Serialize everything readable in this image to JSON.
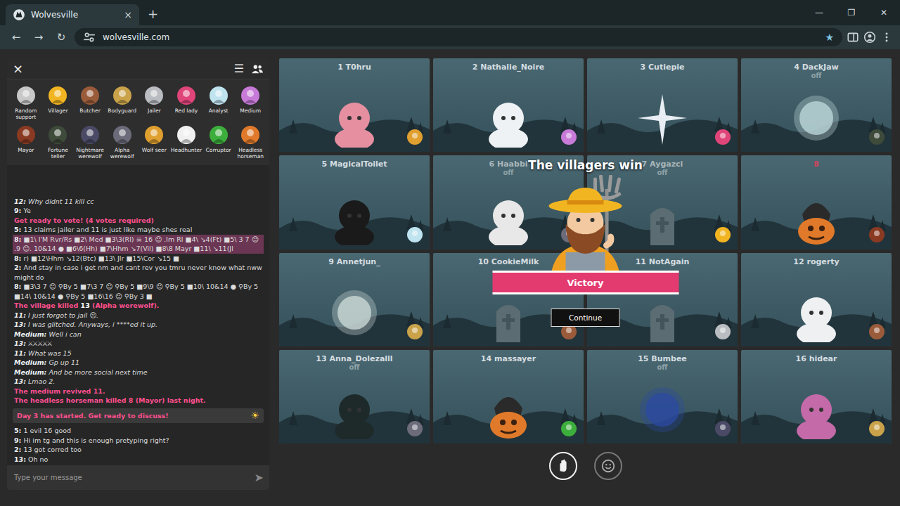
{
  "browser": {
    "tab_title": "Wolvesville",
    "tab_close": "×",
    "new_tab": "+",
    "window_controls": [
      "—",
      "❐",
      "✕"
    ],
    "nav": [
      "←",
      "→",
      "↻"
    ],
    "url": "wolvesville.com",
    "star": "★"
  },
  "panel": {
    "close": "×",
    "menu": "☰",
    "roles": [
      {
        "label": "Random support",
        "color": "#c8c8c8"
      },
      {
        "label": "Villager",
        "color": "#f2b522"
      },
      {
        "label": "Butcher",
        "color": "#9a5b3a"
      },
      {
        "label": "Bodyguard",
        "color": "#c9a24a"
      },
      {
        "label": "Jailer",
        "color": "#b9bcc0"
      },
      {
        "label": "Red lady",
        "color": "#e0457a"
      },
      {
        "label": "Analyst",
        "color": "#bfe3ef"
      },
      {
        "label": "Medium",
        "color": "#c77ad8"
      },
      {
        "label": "Mayor",
        "color": "#8a3a22"
      },
      {
        "label": "Fortune teller",
        "color": "#3e4a3a"
      },
      {
        "label": "Nightmare werewolf",
        "color": "#4a4a66"
      },
      {
        "label": "Alpha werewolf",
        "color": "#6b6b7a"
      },
      {
        "label": "Wolf seer",
        "color": "#e0a030"
      },
      {
        "label": "Headhunter",
        "color": "#f0f0f0"
      },
      {
        "label": "Corruptor",
        "color": "#3cae3c"
      },
      {
        "label": "Headless horseman",
        "color": "#e07a2a"
      }
    ],
    "chat": [
      {
        "kind": "italic",
        "speaker": "12:",
        "text": "Why didnt 11 kill cc"
      },
      {
        "kind": "plain",
        "speaker": "9:",
        "text": "Ye"
      },
      {
        "kind": "system",
        "text": "Get ready to vote! (4 votes required)"
      },
      {
        "kind": "plain",
        "speaker": "5:",
        "text": "13 claims jailer and 11 is just like maybe shes real"
      },
      {
        "kind": "note",
        "speaker": "8:",
        "text": "■1\\ I'M Rvr/Rs ■2\\ Med ■3\\3(Rl) ☠ 16 ☺ .Im Rl ■4\\ ↘4(Ft) ■5\\ 3 7 ☺ .9 ☺. 10&14 ● ■6\\6(Hh) ■7\\Hhm ↘7(Vil) ■8\\8 Mayr ■11\\ ↘11(Jl"
      },
      {
        "kind": "plain",
        "speaker": "8:",
        "text": "r) ■12\\Hhm ↘12(Btc) ■13\\ Jlr ■15\\Cor ↘15 ■"
      },
      {
        "kind": "plain",
        "speaker": "2:",
        "text": "And stay in case i get nm and cant rev you tmru never know what nww might do"
      },
      {
        "kind": "plain",
        "speaker": "8:",
        "text": "■3\\3 7 ☺ ⚲By 5 ■7\\3 7 ☺ ⚲By 5 ■9\\9 ☺ ⚲By 5 ■10\\ 10&14 ● ⚲By 5 ■14\\ 10&14 ● ⚲By 5 ■16\\16 ☺ ⚲By 3 ■"
      },
      {
        "kind": "kill",
        "before": "The village killed ",
        "target": "13",
        "after": " (Alpha werewolf)."
      },
      {
        "kind": "italic",
        "speaker": "11:",
        "text": "I just forgot to jail ☹."
      },
      {
        "kind": "italic",
        "speaker": "13:",
        "text": "I was glitched. Anyways, i ****ed it up."
      },
      {
        "kind": "italic",
        "speaker": "Medium:",
        "text": "Well i can"
      },
      {
        "kind": "italic",
        "speaker": "13:",
        "text": "⚔⚔⚔⚔⚔"
      },
      {
        "kind": "italic",
        "speaker": "11:",
        "text": "What was 15"
      },
      {
        "kind": "italic",
        "speaker": "Medium:",
        "text": "Gp up 11"
      },
      {
        "kind": "italic",
        "speaker": "Medium:",
        "text": "And be more social next time"
      },
      {
        "kind": "italic",
        "speaker": "13:",
        "text": "Lmao 2."
      },
      {
        "kind": "system",
        "text": "The medium revived 11."
      },
      {
        "kind": "system",
        "text": "The headless horseman killed 8 (Mayor) last night."
      },
      {
        "kind": "day",
        "text": "Day 3 has started. Get ready to discuss!",
        "icon": "☀"
      },
      {
        "kind": "plain",
        "speaker": "5:",
        "text": "1 evil 16 good"
      },
      {
        "kind": "plain",
        "speaker": "9:",
        "text": "Hi im tg and this is enough pretyping right?"
      },
      {
        "kind": "plain",
        "speaker": "2:",
        "text": "13 got corred too"
      },
      {
        "kind": "plain",
        "speaker": "13:",
        "text": "Oh no"
      }
    ],
    "input_placeholder": "Type your message",
    "send": "➤"
  },
  "players": [
    {
      "name": "1 T0hru",
      "off": false,
      "kind": "figure",
      "color": "#e58fa0",
      "name_color": "#d5dde0",
      "role_color": "#e0a030"
    },
    {
      "name": "2 Nathalie_Noire",
      "off": false,
      "kind": "figure",
      "color": "#eef2f4",
      "name_color": "#d5dde0",
      "role_color": "#c77ad8"
    },
    {
      "name": "3 Cutiepie",
      "off": false,
      "kind": "star",
      "color": "#e8eef4",
      "name_color": "#d5dde0",
      "role_color": "#e0457a"
    },
    {
      "name": "4 DackJaw",
      "off": true,
      "kind": "moon",
      "color": "#bcd6d8",
      "name_color": "#d5dde0",
      "role_color": "#3e4a3a"
    },
    {
      "name": "5 MagicalToilet",
      "off": false,
      "kind": "figure",
      "color": "#1a1a1a",
      "name_color": "#d5dde0",
      "role_color": "#bfe3ef"
    },
    {
      "name": "6 Haabbi",
      "off": true,
      "kind": "figure",
      "color": "#e8e8e8",
      "name_color": "#aab6ba",
      "role_color": "#6b6b7a"
    },
    {
      "name": "7 Aygazci",
      "off": true,
      "kind": "tombstone",
      "color": "#5b6d72",
      "name_color": "#aab6ba",
      "role_color": "#f2b522"
    },
    {
      "name": "8",
      "off": false,
      "kind": "pumpkin",
      "color": "#e07a2a",
      "name_color": "#d8435e",
      "role_color": "#8a3a22"
    },
    {
      "name": "9 Annetjun_",
      "off": false,
      "kind": "moon",
      "color": "#c9d8d4",
      "name_color": "#d5dde0",
      "role_color": "#c9a24a"
    },
    {
      "name": "10 CookieMilk",
      "off": false,
      "kind": "tombstone",
      "color": "#5b6d72",
      "name_color": "#d5dde0",
      "role_color": "#9a5b3a"
    },
    {
      "name": "11 NotAgain",
      "off": false,
      "kind": "tombstone",
      "color": "#5b6d72",
      "name_color": "#d5dde0",
      "role_color": "#b9bcc0"
    },
    {
      "name": "12 rogerty",
      "off": false,
      "kind": "figure",
      "color": "#eef0f2",
      "name_color": "#d5dde0",
      "role_color": "#9a5b3a"
    },
    {
      "name": "13 Anna_Dolezalll",
      "off": true,
      "kind": "figure",
      "color": "#1e2a2a",
      "name_color": "#d5dde0",
      "role_color": "#6b6b7a"
    },
    {
      "name": "14 massayer",
      "off": false,
      "kind": "pumpkin",
      "color": "#e07a2a",
      "name_color": "#d5dde0",
      "role_color": "#3cae3c"
    },
    {
      "name": "15 Bumbee",
      "off": true,
      "kind": "moon",
      "color": "#2c4aa0",
      "name_color": "#d5dde0",
      "role_color": "#4a4a66"
    },
    {
      "name": "16 hidear",
      "off": false,
      "kind": "figure",
      "color": "#c46aa8",
      "name_color": "#d5dde0",
      "role_color": "#c9a24a"
    }
  ],
  "result": {
    "title": "The villagers win",
    "ribbon": "Victory",
    "button": "Continue"
  },
  "actions": [
    {
      "selected": true
    },
    {
      "selected": false
    }
  ]
}
